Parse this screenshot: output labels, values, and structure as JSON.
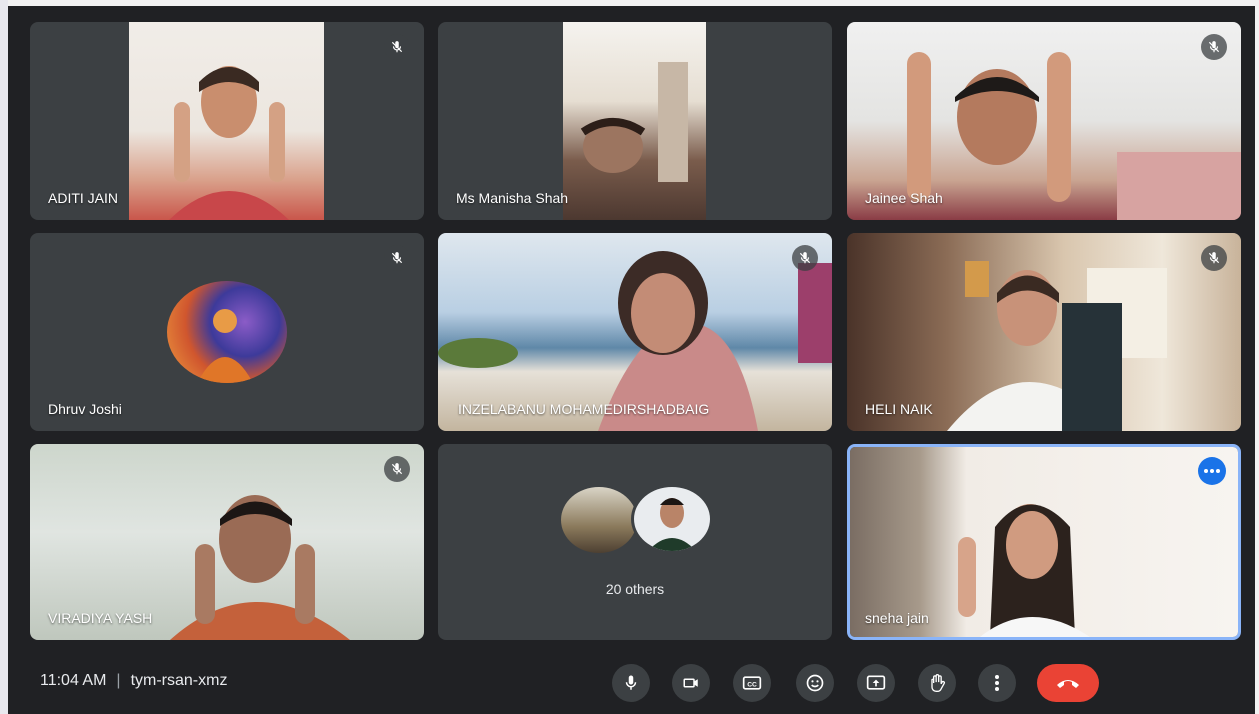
{
  "participants": [
    {
      "name": "ADITI JAIN",
      "muted": true
    },
    {
      "name": "Ms Manisha Shah",
      "muted": false
    },
    {
      "name": "Jainee Shah",
      "muted": true
    },
    {
      "name": "Dhruv Joshi",
      "muted": true
    },
    {
      "name": "INZELABANU MOHAMEDIRSHADBAIG",
      "muted": true
    },
    {
      "name": "HELI NAIK",
      "muted": true
    },
    {
      "name": "VIRADIYA YASH",
      "muted": true
    },
    {
      "name": "sneha jain",
      "muted": false,
      "active_speaker": true
    }
  ],
  "others": {
    "label": "20 others"
  },
  "meeting": {
    "time": "11:04 AM",
    "code": "tym-rsan-xmz"
  },
  "controls": [
    {
      "icon": "microphone-icon"
    },
    {
      "icon": "camera-icon"
    },
    {
      "icon": "captions-icon"
    },
    {
      "icon": "emoji-icon"
    },
    {
      "icon": "present-screen-icon"
    },
    {
      "icon": "raise-hand-icon"
    },
    {
      "icon": "more-options-icon"
    },
    {
      "icon": "end-call-icon"
    }
  ],
  "colors": {
    "background": "#202124",
    "tile": "#3c4043",
    "end_call": "#ea4335",
    "active_border": "#8ab4f8",
    "accent": "#1a73e8"
  }
}
